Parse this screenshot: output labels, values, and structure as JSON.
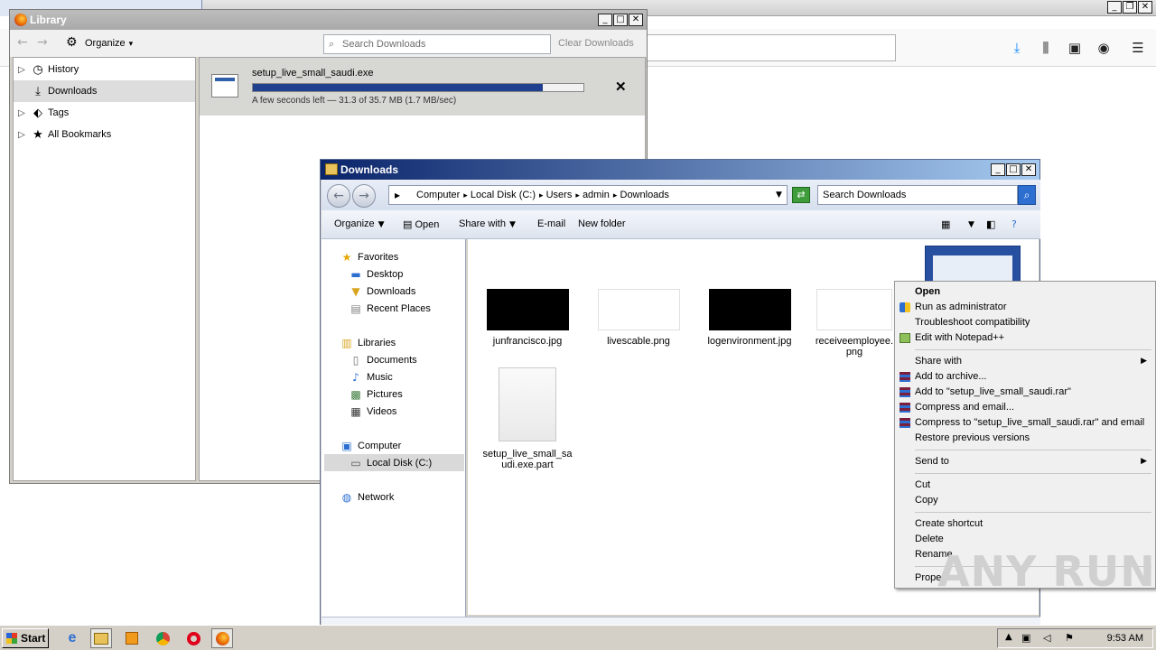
{
  "firefox": {
    "toolbar_icons": [
      "download-arrow-icon",
      "library-icon",
      "sidebar-icon",
      "account-icon",
      "menu-icon"
    ]
  },
  "library": {
    "title": "Library",
    "organize_label": "Organize",
    "search_placeholder": "Search Downloads",
    "clear_label": "Clear Downloads",
    "sidebar": [
      {
        "label": "History",
        "icon": "clock-icon"
      },
      {
        "label": "Downloads",
        "icon": "download-icon"
      },
      {
        "label": "Tags",
        "icon": "tag-icon"
      },
      {
        "label": "All Bookmarks",
        "icon": "star-icon"
      }
    ],
    "download": {
      "name": "setup_live_small_saudi.exe",
      "status": "A few seconds left — 31.3 of 35.7 MB (1.7 MB/sec)",
      "progress": 0.877
    }
  },
  "explorer": {
    "title": "Downloads",
    "breadcrumb": [
      "Computer",
      "Local Disk (C:)",
      "Users",
      "admin",
      "Downloads"
    ],
    "search_placeholder": "Search Downloads",
    "commands": {
      "organize": "Organize",
      "open": "Open",
      "share": "Share with",
      "email": "E-mail",
      "new_folder": "New folder"
    },
    "tree": {
      "favorites": "Favorites",
      "desktop": "Desktop",
      "downloads": "Downloads",
      "recent": "Recent Places",
      "libraries": "Libraries",
      "documents": "Documents",
      "music": "Music",
      "pictures": "Pictures",
      "videos": "Videos",
      "computer": "Computer",
      "local_disk": "Local Disk (C:)",
      "network": "Network"
    },
    "files": [
      {
        "name": "junfrancisco.jpg"
      },
      {
        "name": "livescable.png"
      },
      {
        "name": "logenvironment.jpg"
      },
      {
        "name": "receiveemployee.png"
      },
      {
        "name": "setup_live_small_saudi.exe.part"
      }
    ]
  },
  "context_menu": {
    "open": "Open",
    "run_admin": "Run as administrator",
    "troubleshoot": "Troubleshoot compatibility",
    "notepad": "Edit with Notepad++",
    "share_with": "Share with",
    "add_archive": "Add to archive...",
    "add_rar": "Add to \"setup_live_small_saudi.rar\"",
    "compress_email": "Compress and email...",
    "compress_rar_email": "Compress to \"setup_live_small_saudi.rar\" and email",
    "restore": "Restore previous versions",
    "send_to": "Send to",
    "cut": "Cut",
    "copy": "Copy",
    "create_shortcut": "Create shortcut",
    "delete": "Delete",
    "rename": "Rename",
    "properties": "Properties"
  },
  "watermark": "ANY RUN",
  "taskbar": {
    "start": "Start",
    "clock": "9:53 AM"
  }
}
